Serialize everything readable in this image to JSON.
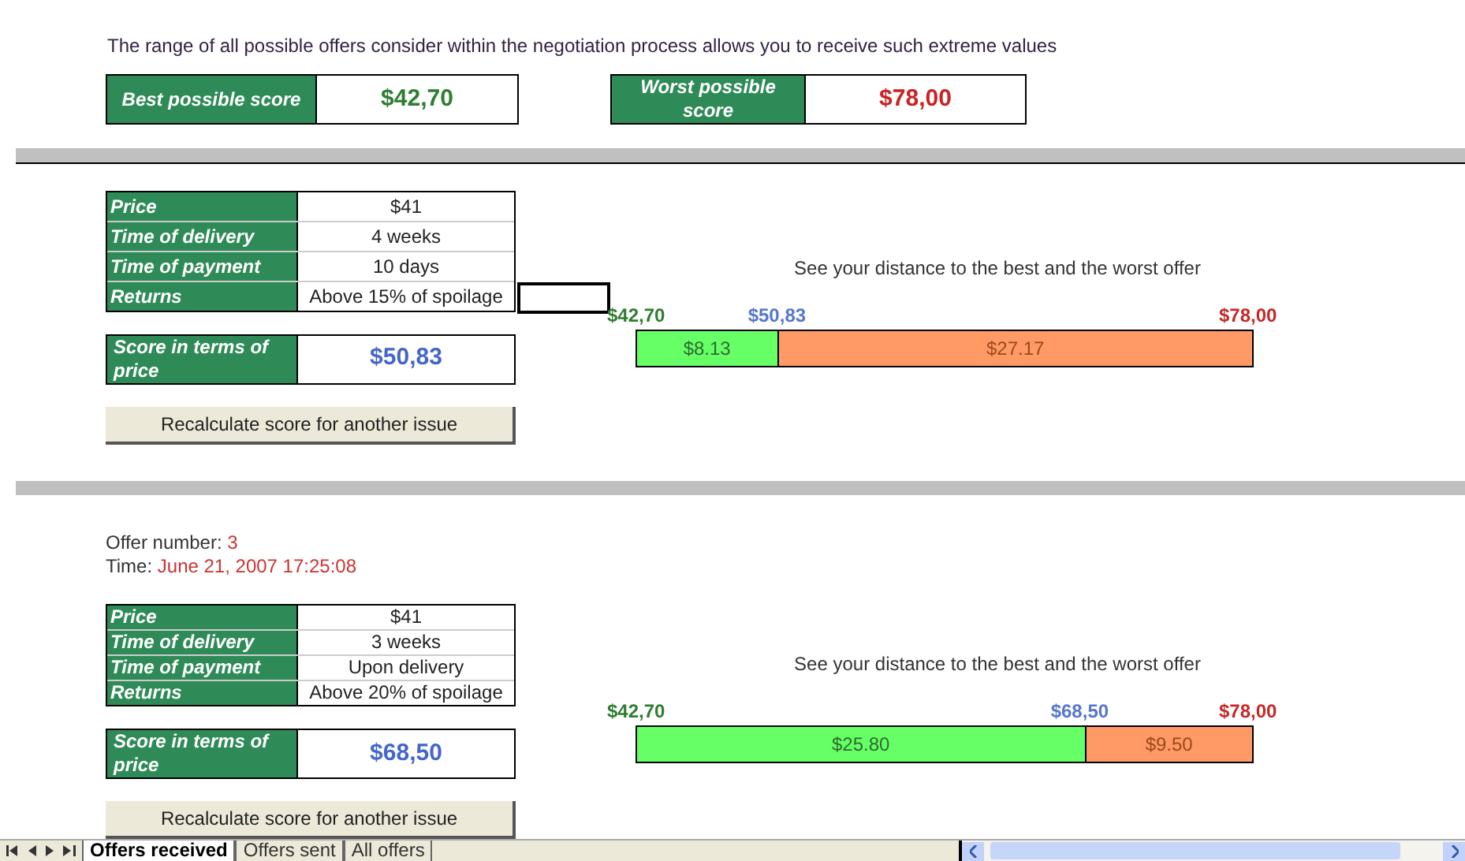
{
  "intro": "The range of all possible offers consider within the negotiation process allows you to receive such extreme values",
  "best": {
    "label": "Best possible score",
    "value": "$42,70"
  },
  "worst": {
    "label": "Worst possible score",
    "value": "$78,00"
  },
  "offers": [
    {
      "issues": [
        {
          "label": "Price",
          "value": "$41"
        },
        {
          "label": "Time of delivery",
          "value": "4 weeks"
        },
        {
          "label": "Time of payment",
          "value": "10 days"
        },
        {
          "label": "Returns",
          "value": "Above 15% of spoilage"
        }
      ],
      "cell_selected": true,
      "score_label": "Score in terms of price",
      "score": "$50,83",
      "button": "Recalculate score for another issue",
      "distance": {
        "title": "See your distance to the best and the worst offer",
        "best": "$42,70",
        "current": "$50,83",
        "worst": "$78,00",
        "level": 0.23,
        "to_best": "$8.13",
        "to_worst": "$27.17"
      }
    },
    {
      "header": {
        "number_label": "Offer number:",
        "number": "3",
        "time_label": "Time:",
        "time": "June 21, 2007 17:25:08"
      },
      "issues": [
        {
          "label": "Price",
          "value": "$41"
        },
        {
          "label": "Time of delivery",
          "value": "3 weeks"
        },
        {
          "label": "Time of payment",
          "value": "Upon delivery"
        },
        {
          "label": "Returns",
          "value": "Above 20% of spoilage"
        }
      ],
      "cell_selected": false,
      "score_label": "Score in terms of price",
      "score": "$68,50",
      "button": "Recalculate score for another issue",
      "distance": {
        "title": "See your distance to the best and the worst offer",
        "best": "$42,70",
        "current": "$68,50",
        "worst": "$78,00",
        "level": 0.73,
        "to_best": "$25.80",
        "to_worst": "$9.50"
      }
    }
  ],
  "sheet_tabs": [
    {
      "label": "Offers received",
      "selected": true
    },
    {
      "label": "Offers sent",
      "selected": false
    },
    {
      "label": "All offers",
      "selected": false
    }
  ]
}
